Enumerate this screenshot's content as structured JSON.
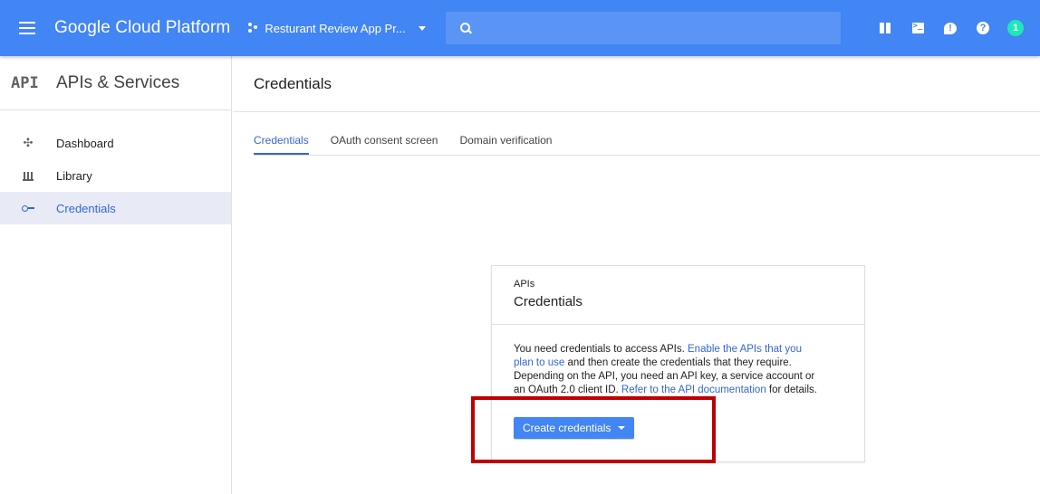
{
  "topbar": {
    "brand": "Google Cloud Platform",
    "project": "Resturant Review App Pr...",
    "notification_count": "1",
    "icons": [
      "menu-icon",
      "project-icon",
      "search-icon",
      "gift-icon",
      "cloud-shell-icon",
      "feedback-icon",
      "help-icon",
      "account-avatar"
    ]
  },
  "sidebar": {
    "logo": "API",
    "title": "APIs & Services",
    "items": [
      {
        "label": "Dashboard",
        "icon": "dashboard-icon"
      },
      {
        "label": "Library",
        "icon": "library-icon"
      },
      {
        "label": "Credentials",
        "icon": "key-icon",
        "active": true
      }
    ]
  },
  "main": {
    "title": "Credentials",
    "tabs": [
      {
        "label": "Credentials",
        "active": true
      },
      {
        "label": "OAuth consent screen"
      },
      {
        "label": "Domain verification"
      }
    ]
  },
  "card": {
    "subtitle": "APIs",
    "title": "Credentials",
    "text_1": "You need credentials to access APIs. ",
    "link_1": "Enable the APIs that you plan to use",
    "text_2": " and then create the credentials that they require. Depending on the API, you need an API key, a service account or an OAuth 2.0 client ID. ",
    "link_2": "Refer to the API documentation",
    "text_3": " for details.",
    "button": "Create credentials"
  },
  "colors": {
    "topbar": "#4285f4",
    "accent": "#3367d6",
    "highlight": "#c00000"
  }
}
